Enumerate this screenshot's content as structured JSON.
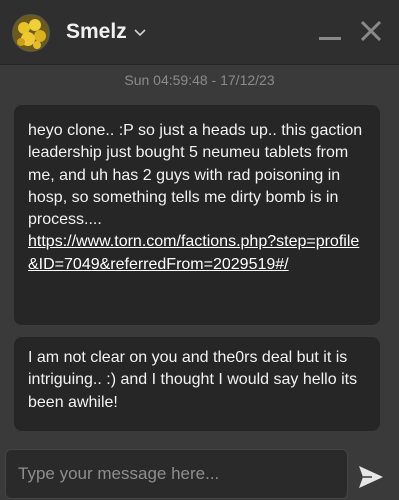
{
  "header": {
    "user_name": "Smelz"
  },
  "chat": {
    "timestamp": "Sun 04:59:48 - 17/12/23",
    "messages": [
      {
        "text": "heyo clone.. :P so just a heads up.. this gaction leadership just bought 5 neumeu tablets from me, and uh has 2 guys with rad poisoning in hosp, so something tells me dirty bomb is in process....",
        "link": "https://www.torn.com/factions.php?step=profile&ID=7049&referredFrom=2029519#/"
      },
      {
        "text": "I am not clear on you and the0rs deal but it is intriguing.. :) and I thought I would say hello its been awhile!"
      }
    ]
  },
  "composer": {
    "placeholder": "Type your message here..."
  },
  "icons": {
    "avatar": "avatar-flowers",
    "dropdown": "chevron-down-icon",
    "minimize": "minimize-icon",
    "close": "close-icon",
    "send": "send-icon"
  }
}
